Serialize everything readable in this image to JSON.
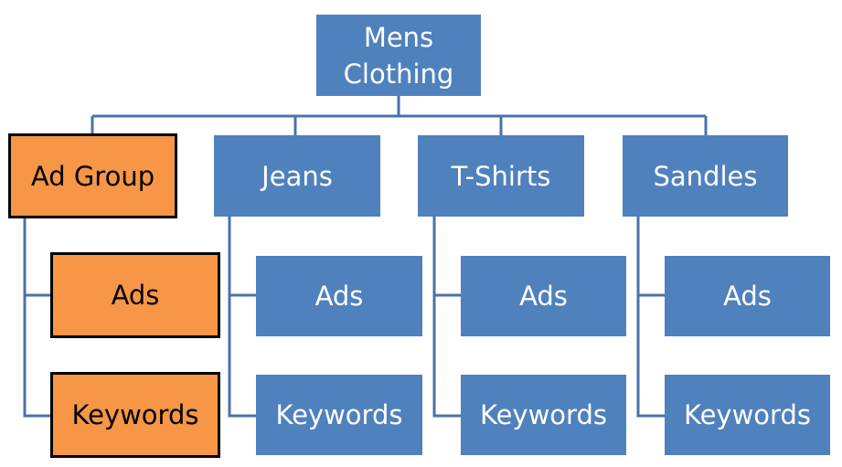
{
  "colors": {
    "node": "#4f81bd",
    "highlight": "#f79646",
    "connector": "#4a72a8"
  },
  "root": {
    "label": "Mens\nClothing"
  },
  "groups": [
    {
      "label": "Ad Group",
      "highlight": true,
      "children": [
        "Ads",
        "Keywords"
      ]
    },
    {
      "label": "Jeans",
      "highlight": false,
      "children": [
        "Ads",
        "Keywords"
      ]
    },
    {
      "label": "T-Shirts",
      "highlight": false,
      "children": [
        "Ads",
        "Keywords"
      ]
    },
    {
      "label": "Sandles",
      "highlight": false,
      "children": [
        "Ads",
        "Keywords"
      ]
    }
  ]
}
